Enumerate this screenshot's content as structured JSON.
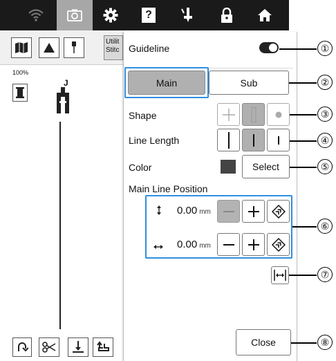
{
  "topbar": {
    "icons": [
      "wifi-icon",
      "camera-icon",
      "gear-icon",
      "help-icon",
      "presser-foot-icon",
      "lock-icon",
      "home-icon"
    ],
    "help_glyph": "?"
  },
  "left_panel": {
    "stitch_label_line1": "Utilit",
    "stitch_label_line2": "Stitc",
    "zoom": "100%",
    "presser_letter": "J"
  },
  "dialog": {
    "guideline_label": "Guideline",
    "guideline_on": true,
    "tabs": [
      {
        "label": "Main",
        "selected": true
      },
      {
        "label": "Sub",
        "selected": false
      }
    ],
    "shape_label": "Shape",
    "line_length_label": "Line Length",
    "color_label": "Color",
    "color_value": "#444444",
    "select_label": "Select",
    "main_line_position_label": "Main Line Position",
    "vertical": {
      "value": "0.00",
      "unit": "mm"
    },
    "horizontal": {
      "value": "0.00",
      "unit": "mm"
    },
    "close_label": "Close"
  },
  "callouts": [
    "①",
    "②",
    "③",
    "④",
    "⑤",
    "⑥",
    "⑦",
    "⑧"
  ],
  "colors": {
    "highlight": "#2f8fe0",
    "topbar": "#1a1a1a",
    "selected": "#b0b0b0"
  }
}
